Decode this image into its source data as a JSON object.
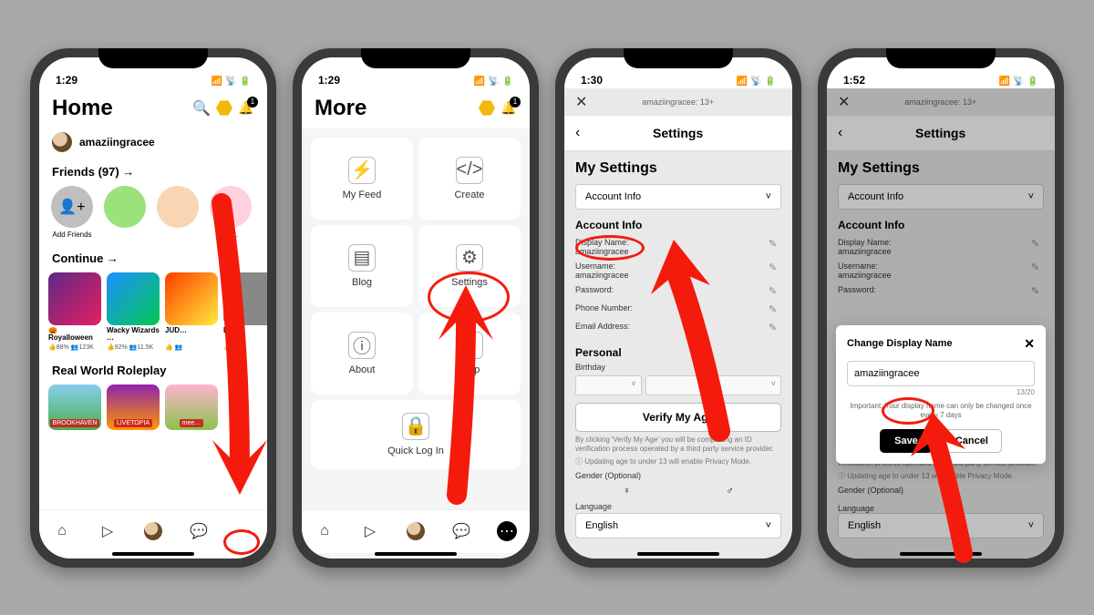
{
  "statusbar": {
    "time1": "1:29",
    "time2": "1:29",
    "time3": "1:30",
    "time4": "1:52",
    "signal": "▂▄▆█",
    "wifi": "⬙",
    "battery": "▮▮▮"
  },
  "badge_count": "1",
  "screen1": {
    "title": "Home",
    "username": "amaziingracee",
    "friends_header": "Friends (97) →",
    "friends": [
      {
        "name": "Add Friends",
        "color": "#bfbfbf"
      },
      {
        "name": "",
        "color": "#9be27a"
      },
      {
        "name": "",
        "color": "#f8d6b3"
      },
      {
        "name": "18…",
        "color": "#ffd1dc"
      }
    ],
    "continue_header": "Continue →",
    "games": [
      {
        "name": "🎃Royalloween",
        "like": "88%",
        "plays": "123K",
        "bg": "linear-gradient(135deg,#5b2a86,#e91e63)"
      },
      {
        "name": "Wacky Wizards …",
        "like": "92%",
        "plays": "11.5K",
        "bg": "linear-gradient(135deg,#1e90ff,#00c853)"
      },
      {
        "name": "JUD…",
        "like": "",
        "plays": "",
        "bg": "linear-gradient(135deg,#ff3d00,#ffeb3b)"
      },
      {
        "name": "D…",
        "like": "",
        "plays": "",
        "bg": "#888"
      }
    ],
    "realworld_header": "Real World Roleplay",
    "games2": [
      {
        "name": "BROOKHAVEN",
        "bg": "linear-gradient(#87ceeb,#4caf50)"
      },
      {
        "name": "LIVETOPIA",
        "bg": "linear-gradient(#8e24aa,#ff9800)"
      },
      {
        "name": "mee…",
        "bg": "linear-gradient(#ffb3d1,#8bc34a)"
      }
    ]
  },
  "screen2": {
    "title": "More",
    "tiles": [
      {
        "icon": "bolt",
        "label": "My Feed"
      },
      {
        "icon": "code",
        "label": "Create"
      },
      {
        "icon": "blog",
        "label": "Blog"
      },
      {
        "icon": "gear",
        "label": "Settings"
      },
      {
        "icon": "info",
        "label": "About"
      },
      {
        "icon": "help",
        "label": "Help"
      },
      {
        "icon": "lock",
        "label": "Quick Log In"
      }
    ]
  },
  "screen3": {
    "topbar_text": "amaziingracee: 13+",
    "header": "Settings",
    "my_settings": "My Settings",
    "dropdown": "Account Info",
    "section_account": "Account Info",
    "display_name_label": "Display Name:",
    "display_name_val": "amaziingracee",
    "username_label": "Username:",
    "username_val": "amaziingracee",
    "password_label": "Password:",
    "phone_label": "Phone Number:",
    "email_label": "Email Address:",
    "section_personal": "Personal",
    "birthday_label": "Birthday",
    "verify_btn": "Verify My Age",
    "verify_text": "By clicking 'Verify My Age' you will be completing an ID verification process operated by a third party service provider.",
    "age_note": "Updating age to under 13 will enable Privacy Mode.",
    "gender_label": "Gender (Optional)",
    "language_label": "Language",
    "language_val": "English"
  },
  "screen4": {
    "modal_title": "Change Display Name",
    "input_val": "amaziingracee",
    "counter": "13/20",
    "note": "Important: Your display name can only be changed once every 7 days",
    "save": "Save",
    "cancel": "Cancel"
  }
}
